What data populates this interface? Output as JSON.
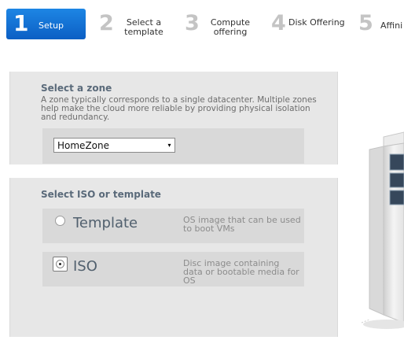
{
  "wizard": {
    "steps": [
      {
        "number": "1",
        "label": "Setup",
        "active": true
      },
      {
        "number": "2",
        "label": "Select a\ntemplate"
      },
      {
        "number": "3",
        "label": "Compute\noffering"
      },
      {
        "number": "4",
        "label": "Disk Offering"
      },
      {
        "number": "5",
        "label": "Affini"
      }
    ]
  },
  "zone": {
    "title": "Select a zone",
    "description": "A zone typically corresponds to a single datacenter. Multiple zones help make the cloud more reliable by providing physical isolation and redundancy.",
    "selected": "HomeZone",
    "arrow": "▾"
  },
  "source": {
    "title": "Select ISO or template",
    "options": [
      {
        "label": "Template",
        "description": "OS image that can be used to boot VMs",
        "selected": false
      },
      {
        "label": "ISO",
        "description": "Disc image containing data or bootable media for OS",
        "selected": true
      }
    ]
  }
}
